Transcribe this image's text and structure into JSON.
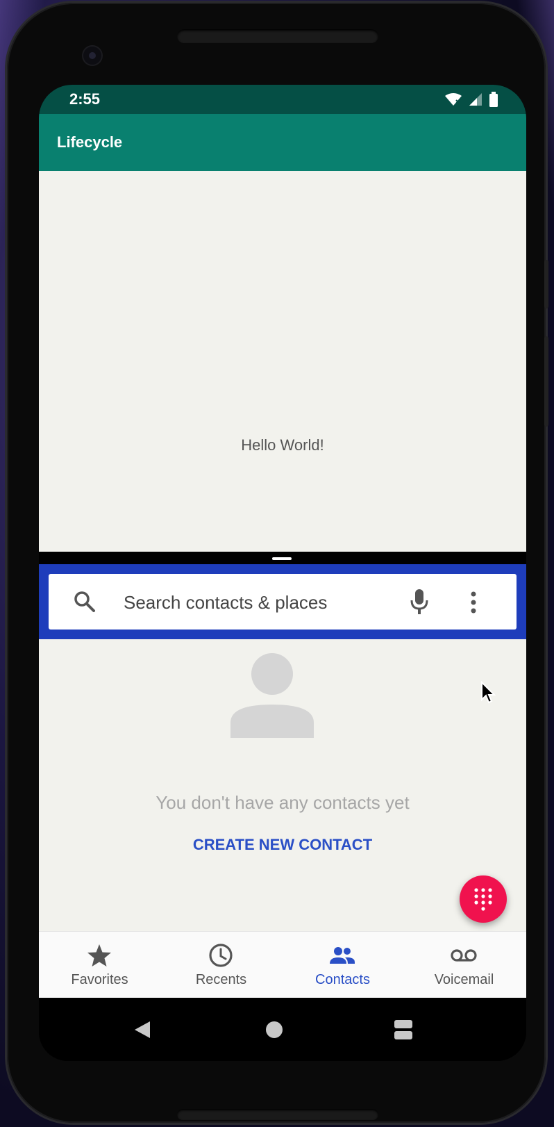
{
  "status_bar": {
    "time": "2:55"
  },
  "app": {
    "title": "Lifecycle",
    "body_text": "Hello World!"
  },
  "dialer": {
    "search": {
      "placeholder": "Search contacts & places"
    },
    "empty_state": {
      "message": "You don't have any contacts yet",
      "action_label": "CREATE NEW CONTACT"
    },
    "bottom_nav": {
      "items": [
        {
          "label": "Favorites",
          "icon": "star-icon",
          "active": false
        },
        {
          "label": "Recents",
          "icon": "clock-icon",
          "active": false
        },
        {
          "label": "Contacts",
          "icon": "people-icon",
          "active": true
        },
        {
          "label": "Voicemail",
          "icon": "voicemail-icon",
          "active": false
        }
      ]
    }
  },
  "colors": {
    "app_bar": "#09806f",
    "status_bar": "#054f45",
    "search_band": "#1e3dbb",
    "accent_blue": "#2a4fc6",
    "fab": "#f0124e"
  }
}
